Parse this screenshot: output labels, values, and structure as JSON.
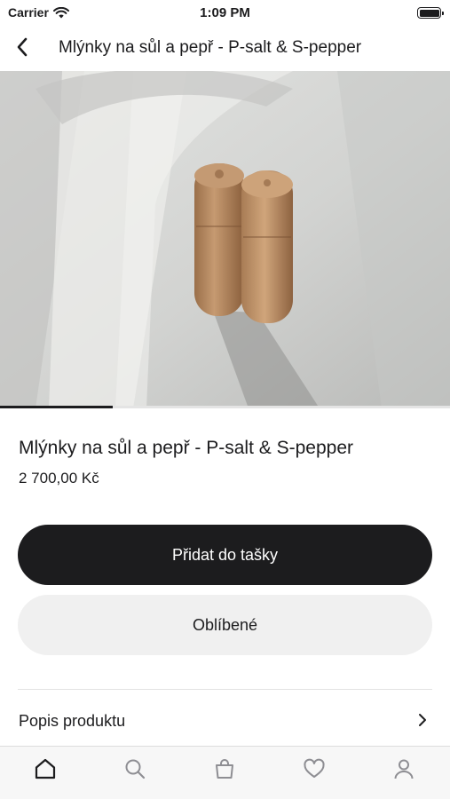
{
  "status_bar": {
    "carrier": "Carrier",
    "time": "1:09 PM"
  },
  "nav": {
    "title": "Mlýnky na sůl a pepř - P-salt & S-pepper",
    "back_icon": "chevron-left-icon"
  },
  "gallery": {
    "image": "wooden salt and pepper grinders photo",
    "progress": 0.25
  },
  "product": {
    "name": "Mlýnky na sůl a pepř - P-salt & S-pepper",
    "price": "2 700,00 Kč"
  },
  "actions": {
    "add_to_bag_label": "Přidat do tašky",
    "favorite_label": "Oblíbené"
  },
  "description": {
    "label": "Popis produktu",
    "chevron_icon": "chevron-right-icon"
  },
  "tab_bar": {
    "items": [
      "home-icon",
      "search-icon",
      "bag-icon",
      "heart-icon",
      "profile-icon"
    ],
    "active_index": 0
  },
  "colors": {
    "primary": "#1c1c1e",
    "secondary_button": "#f0f0f0",
    "inactive_icon": "#8e8e93"
  }
}
